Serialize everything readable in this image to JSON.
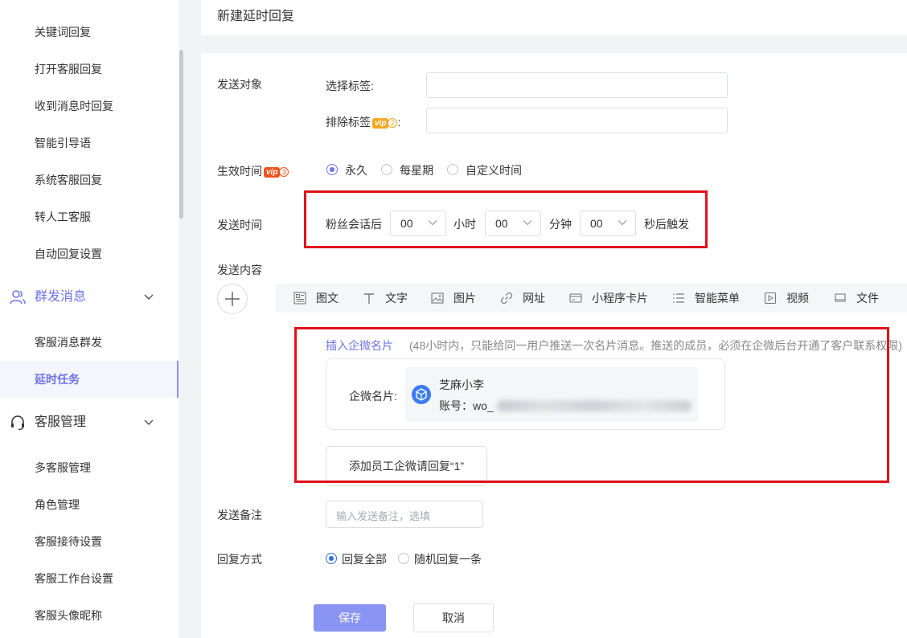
{
  "sidebar": {
    "items_top": [
      {
        "label": "关键词回复"
      },
      {
        "label": "打开客服回复"
      },
      {
        "label": "收到消息时回复"
      },
      {
        "label": "智能引导语"
      },
      {
        "label": "系统客服回复"
      },
      {
        "label": "转人工客服"
      },
      {
        "label": "自动回复设置"
      }
    ],
    "group_mass": {
      "label": "群发消息",
      "icon": "users-icon"
    },
    "items_mass": [
      {
        "label": "客服消息群发"
      },
      {
        "label": "延时任务",
        "active": true
      }
    ],
    "group_service": {
      "label": "客服管理",
      "icon": "headset-icon"
    },
    "items_service": [
      {
        "label": "多客服管理"
      },
      {
        "label": "角色管理"
      },
      {
        "label": "客服接待设置"
      },
      {
        "label": "客服工作台设置"
      },
      {
        "label": "客服头像昵称"
      }
    ]
  },
  "page": {
    "title": "新建延时回复"
  },
  "form": {
    "target": {
      "label": "发送对象",
      "select_tag_label": "选择标签:",
      "exclude_tag_label": "排除标签",
      "exclude_tag_colon": ":",
      "exclude_vip": {
        "text": "vip",
        "level": "2",
        "color": "#f5a623"
      }
    },
    "effective": {
      "label": "生效时间",
      "vip": {
        "text": "vip",
        "level": "3",
        "color": "#f0541e"
      },
      "options": [
        "永久",
        "每星期",
        "自定义时间"
      ],
      "selected": "永久"
    },
    "send_time": {
      "label": "发送时间",
      "prefix": "粉丝会话后",
      "hour_value": "00",
      "hour_unit": "小时",
      "minute_value": "00",
      "minute_unit": "分钟",
      "second_value": "00",
      "suffix": "秒后触发"
    },
    "content": {
      "label": "发送内容",
      "toolbar": [
        {
          "label": "图文",
          "icon": "article-icon"
        },
        {
          "label": "文字",
          "icon": "text-icon"
        },
        {
          "label": "图片",
          "icon": "image-icon"
        },
        {
          "label": "网址",
          "icon": "link-icon"
        },
        {
          "label": "小程序卡片",
          "icon": "miniprogram-card-icon"
        },
        {
          "label": "智能菜单",
          "icon": "menu-icon"
        },
        {
          "label": "视频",
          "icon": "video-icon"
        },
        {
          "label": "文件",
          "icon": "file-icon"
        }
      ],
      "insert_link": "插入企微名片",
      "insert_hint": "(48小时内，只能给同一用户推送一次名片消息。推送的成员，必须在企微后台开通了客户联系权限)",
      "card_label": "企微名片:",
      "card_name": "芝麻小李",
      "card_account": "账号：wo_",
      "reply_button": "添加员工企微请回复“1”"
    },
    "remark": {
      "label": "发送备注",
      "placeholder": "输入发送备注，选填"
    },
    "reply_mode": {
      "label": "回复方式",
      "options": [
        "回复全部",
        "随机回复一条"
      ],
      "selected": "回复全部"
    }
  },
  "buttons": {
    "save": "保存",
    "cancel": "取消"
  },
  "colors": {
    "accent": "#6c74e6",
    "highlight_box": "#e0111a",
    "primary_button": "#8a94f2"
  }
}
